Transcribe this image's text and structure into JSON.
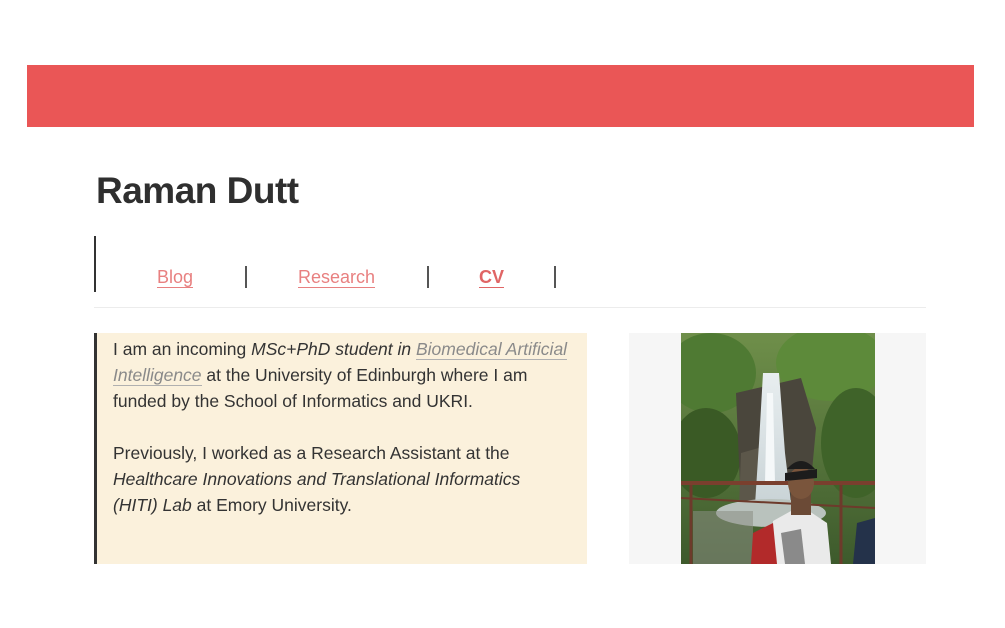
{
  "colors": {
    "banner": "#ea5656",
    "nav_link": "#e88080",
    "nav_link_active": "#e06565",
    "bio_background": "#fbf1dc"
  },
  "site_title": "Raman Dutt",
  "nav": {
    "items": [
      {
        "label": "Blog",
        "active": false
      },
      {
        "label": "Research",
        "active": false
      },
      {
        "label": "CV",
        "active": true
      }
    ]
  },
  "bio": {
    "p1": {
      "t1": "I am an incoming ",
      "em": "MSc+PhD student in ",
      "link": "Biomedical Artificial Intelligence",
      "t2": " at the University of Edinburgh where I am funded by the School of Informatics and UKRI."
    },
    "p2": {
      "t1": "Previously, I worked as a Research Assistant at the ",
      "em": "Healthcare Innovations and Translational Informatics (HITI) Lab",
      "t2": " at Emory University."
    }
  },
  "photo": {
    "description_icon": "profile-photo"
  }
}
